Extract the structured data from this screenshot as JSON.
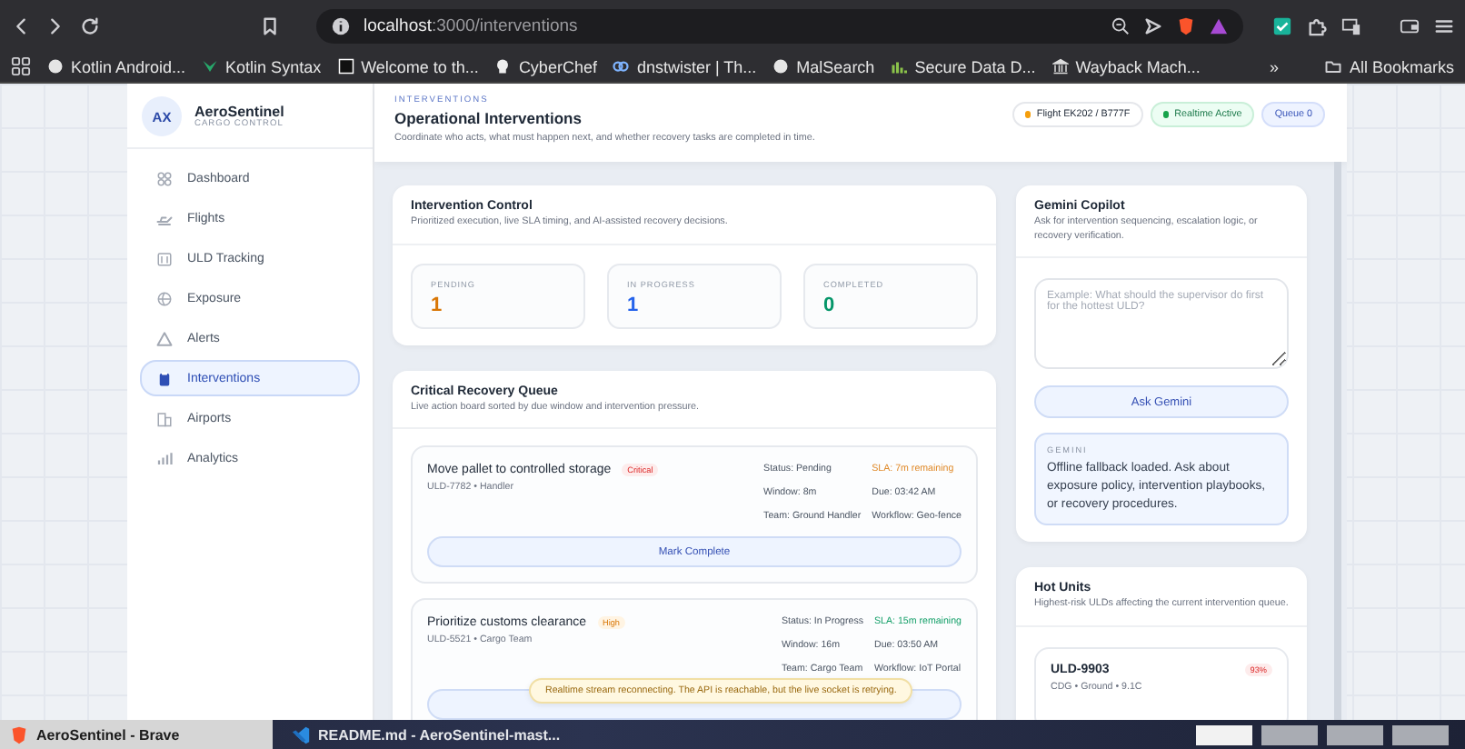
{
  "browser": {
    "url_host": "localhost",
    "url_path": ":3000/interventions",
    "bookmarks": [
      {
        "label": "Kotlin Android..."
      },
      {
        "label": "Kotlin Syntax"
      },
      {
        "label": "Welcome to th..."
      },
      {
        "label": "CyberChef"
      },
      {
        "label": "dnstwister | Th..."
      },
      {
        "label": "MalSearch"
      },
      {
        "label": "Secure Data D..."
      },
      {
        "label": "Wayback Mach..."
      }
    ],
    "overflow": "»",
    "all_bookmarks": "All Bookmarks"
  },
  "sidebar": {
    "avatar": "AX",
    "brand": "AeroSentinel",
    "tagline": "CARGO CONTROL",
    "items": [
      {
        "label": "Dashboard",
        "selected": false
      },
      {
        "label": "Flights",
        "selected": false
      },
      {
        "label": "ULD Tracking",
        "selected": false
      },
      {
        "label": "Exposure",
        "selected": false
      },
      {
        "label": "Alerts",
        "selected": false
      },
      {
        "label": "Interventions",
        "selected": true
      },
      {
        "label": "Airports",
        "selected": false
      },
      {
        "label": "Analytics",
        "selected": false
      }
    ]
  },
  "header": {
    "eyebrow": "INTERVENTIONS",
    "title": "Operational Interventions",
    "subtitle": "Coordinate who acts, what must happen next, and whether recovery tasks are completed in time.",
    "pills": [
      {
        "label": "Flight EK202 / B777F",
        "kind": "flight"
      },
      {
        "label": "Realtime Active",
        "kind": "live"
      },
      {
        "label": "Queue 0",
        "kind": "queue"
      }
    ]
  },
  "control": {
    "title": "Intervention Control",
    "subtitle": "Prioritized execution, live SLA timing, and AI-assisted recovery decisions.",
    "stats": [
      {
        "label": "PENDING",
        "value": "1",
        "color": "#d97706"
      },
      {
        "label": "IN PROGRESS",
        "value": "1",
        "color": "#2563eb"
      },
      {
        "label": "COMPLETED",
        "value": "0",
        "color": "#059669"
      }
    ]
  },
  "queue": {
    "title": "Critical Recovery Queue",
    "subtitle": "Live action board sorted by due window and intervention pressure.",
    "items": [
      {
        "title": "Move pallet to controlled storage",
        "priority": {
          "label": "Critical",
          "kind": "critical"
        },
        "meta": "ULD-7782 • Handler",
        "status": "Status: Pending",
        "sla": {
          "text": "SLA: 7m remaining",
          "kind": "warning"
        },
        "window": "Window: 8m",
        "due": "Due: 03:42 AM",
        "team": "Team: Ground Handler",
        "workflow": "Workflow: Geo-fence",
        "action": "Mark Complete"
      },
      {
        "title": "Prioritize customs clearance",
        "priority": {
          "label": "High",
          "kind": "high"
        },
        "meta": "ULD-5521 • Cargo Team",
        "status": "Status: In Progress",
        "sla": {
          "text": "SLA: 15m remaining",
          "kind": "ok"
        },
        "window": "Window: 16m",
        "due": "Due: 03:50 AM",
        "team": "Team: Cargo Team",
        "workflow": "Workflow: IoT Portal"
      }
    ]
  },
  "toast": "Realtime stream reconnecting. The API is reachable, but the live socket is retrying.",
  "copilot": {
    "title": "Gemini Copilot",
    "subtitle": "Ask for intervention sequencing, escalation logic, or recovery verification.",
    "placeholder": "Example: What should the supervisor do first for the hottest ULD?",
    "button": "Ask Gemini",
    "response_label": "GEMINI",
    "response": "Offline fallback loaded. Ask about exposure policy, intervention playbooks, or recovery procedures."
  },
  "hot_units": {
    "title": "Hot Units",
    "subtitle": "Highest-risk ULDs affecting the current intervention queue.",
    "units": [
      {
        "id": "ULD-9903",
        "risk": "93%",
        "meta": "CDG • Ground • 9.1C"
      }
    ]
  },
  "taskbar": {
    "windows": [
      {
        "label": "AeroSentinel - Brave",
        "selected": true
      },
      {
        "label": "README.md - AeroSentinel-mast...",
        "selected": false
      }
    ],
    "workspaces": [
      {
        "selected": true
      },
      {
        "selected": false
      },
      {
        "selected": false
      },
      {
        "selected": false
      }
    ]
  }
}
